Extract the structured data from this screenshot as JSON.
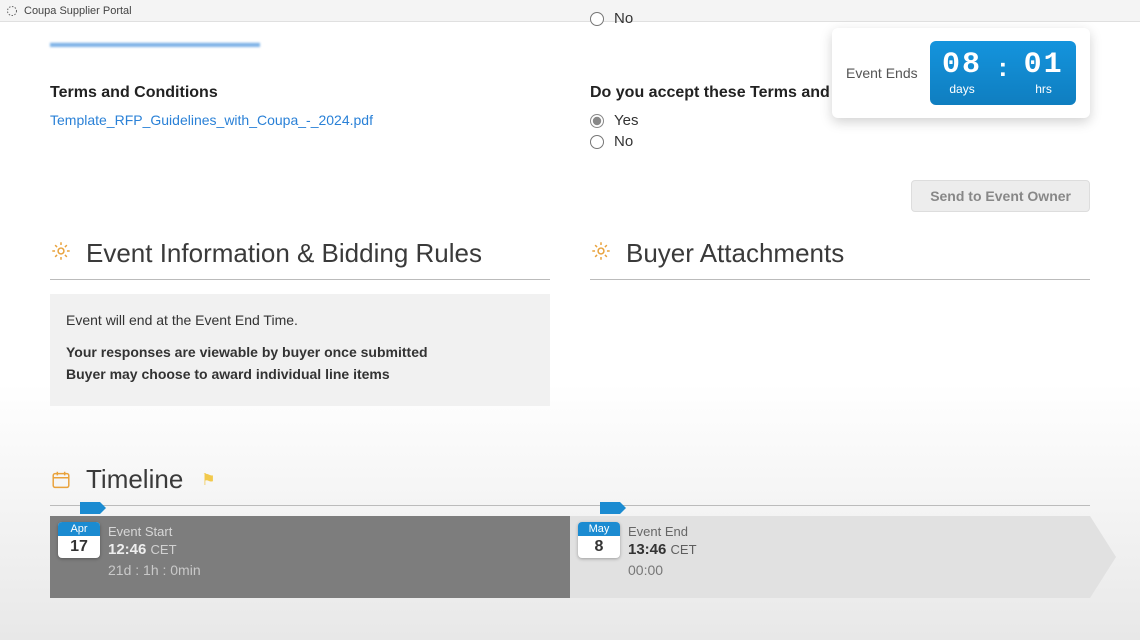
{
  "window": {
    "title": "Coupa Supplier Portal"
  },
  "prev_radio": {
    "no": "No"
  },
  "terms": {
    "heading": "Terms and Conditions",
    "file": "Template_RFP_Guidelines_with_Coupa_-_2024.pdf",
    "question": "Do you accept these Terms and Conditions",
    "yes": "Yes",
    "no": "No"
  },
  "countdown": {
    "label": "Event Ends",
    "days_num": "08",
    "days_cap": "days",
    "hrs_num": "01",
    "hrs_cap": "hrs"
  },
  "buttons": {
    "send_owner": "Send to Event Owner"
  },
  "sections": {
    "event_info": "Event Information & Bidding Rules",
    "attachments": "Buyer Attachments",
    "timeline": "Timeline"
  },
  "info_box": {
    "line1": "Event will end at the Event End Time.",
    "line2": "Your responses are viewable by buyer once submitted",
    "line3": "Buyer may choose to award individual line items"
  },
  "timeline": {
    "start": {
      "month": "Apr",
      "day": "17",
      "title": "Event Start",
      "time": "12:46",
      "tz": "CET",
      "duration": "21d : 1h : 0min"
    },
    "end": {
      "month": "May",
      "day": "8",
      "title": "Event End",
      "time": "13:46",
      "tz": "CET",
      "duration": "00:00"
    }
  }
}
